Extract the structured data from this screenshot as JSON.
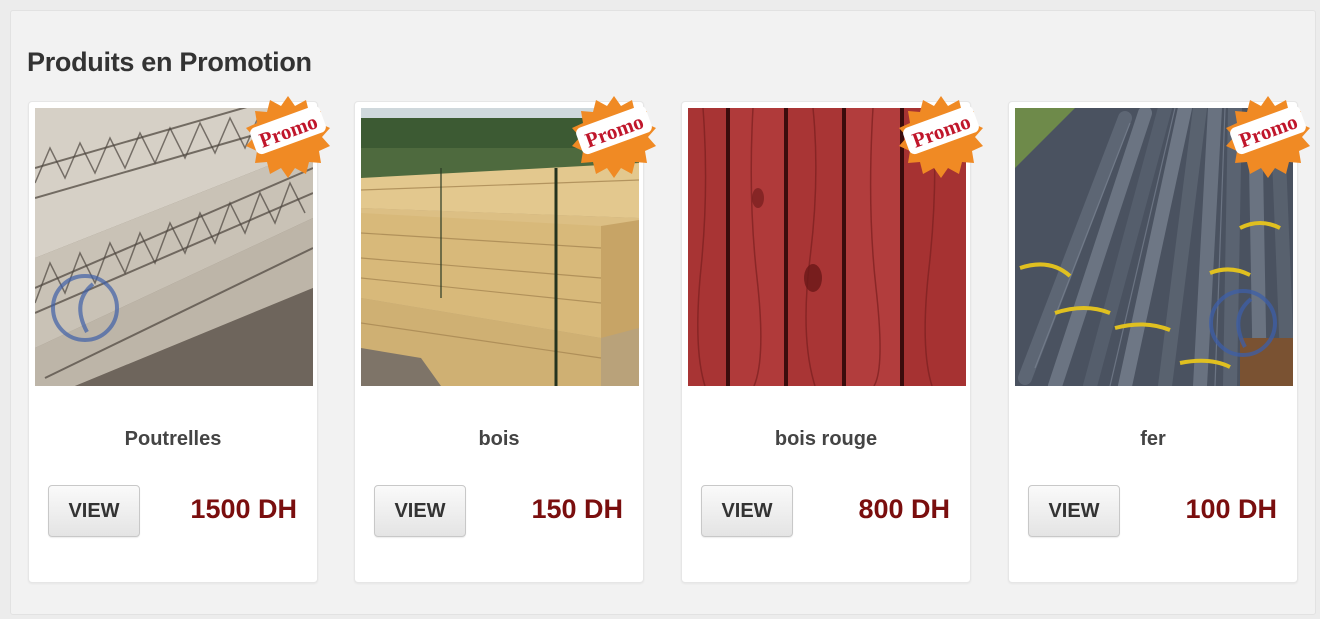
{
  "section": {
    "title": "Produits en Promotion"
  },
  "badge": {
    "label": "Promo",
    "color": "#f08a24"
  },
  "products": [
    {
      "name": "Poutrelles",
      "price": "1500 DH",
      "view_label": "VIEW",
      "image": "steel-beams-image"
    },
    {
      "name": "bois",
      "price": "150 DH",
      "view_label": "VIEW",
      "image": "wood-planks-image"
    },
    {
      "name": "bois rouge",
      "price": "800 DH",
      "view_label": "VIEW",
      "image": "red-wood-image"
    },
    {
      "name": "fer",
      "price": "100 DH",
      "view_label": "VIEW",
      "image": "iron-rebar-image"
    }
  ],
  "colors": {
    "price": "#7a0e0e",
    "panel": "#f2f2f2"
  }
}
